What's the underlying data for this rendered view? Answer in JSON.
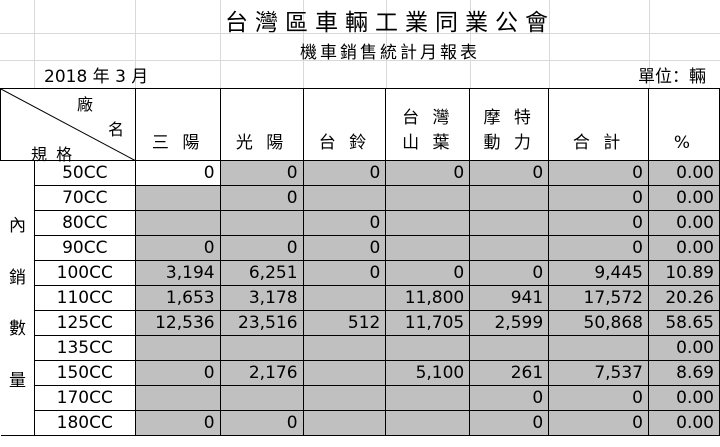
{
  "title": "台灣區車輛工業同業公會",
  "subtitle": "機車銷售統計月報表",
  "date": "2018 年 3 月",
  "unit": "單位：輛",
  "header": {
    "corner_top": "廠",
    "corner_mid": "名",
    "corner_bottom": "規 格",
    "columns": [
      {
        "line1": "",
        "line2": "三 陽"
      },
      {
        "line1": "",
        "line2": "光 陽"
      },
      {
        "line1": "",
        "line2": "台 鈴"
      },
      {
        "line1": "台 灣",
        "line2": "山 葉"
      },
      {
        "line1": "摩 特",
        "line2": "動 力"
      },
      {
        "line1": "",
        "line2": "合 計"
      },
      {
        "line1": "",
        "line2": "%"
      }
    ]
  },
  "category_label": [
    "內",
    "銷",
    "數",
    "量"
  ],
  "rows": [
    {
      "spec": "50CC",
      "cells": [
        "0",
        "0",
        "0",
        "0",
        "0",
        "0",
        "0.00"
      ]
    },
    {
      "spec": "70CC",
      "cells": [
        "",
        "0",
        "",
        "",
        "",
        "0",
        "0.00"
      ]
    },
    {
      "spec": "80CC",
      "cells": [
        "",
        "",
        "0",
        "",
        "",
        "0",
        "0.00"
      ]
    },
    {
      "spec": "90CC",
      "cells": [
        "0",
        "0",
        "0",
        "",
        "",
        "0",
        "0.00"
      ]
    },
    {
      "spec": "100CC",
      "cells": [
        "3,194",
        "6,251",
        "0",
        "0",
        "0",
        "9,445",
        "10.89"
      ]
    },
    {
      "spec": "110CC",
      "cells": [
        "1,653",
        "3,178",
        "",
        "11,800",
        "941",
        "17,572",
        "20.26"
      ]
    },
    {
      "spec": "125CC",
      "cells": [
        "12,536",
        "23,516",
        "512",
        "11,705",
        "2,599",
        "50,868",
        "58.65"
      ]
    },
    {
      "spec": "135CC",
      "cells": [
        "",
        "",
        "",
        "",
        "",
        "",
        "0.00"
      ]
    },
    {
      "spec": "150CC",
      "cells": [
        "0",
        "2,176",
        "",
        "5,100",
        "261",
        "7,537",
        "8.69"
      ]
    },
    {
      "spec": "170CC",
      "cells": [
        "",
        "",
        "",
        "",
        "0",
        "0",
        "0.00"
      ]
    },
    {
      "spec": "180CC",
      "cells": [
        "0",
        "0",
        "",
        "",
        "0",
        "0",
        "0.00"
      ]
    }
  ],
  "white_cells": [
    [
      0,
      0
    ]
  ]
}
